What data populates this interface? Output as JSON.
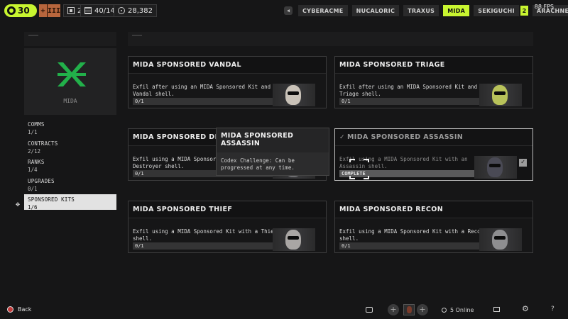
{
  "topbar": {
    "level": "30",
    "rank_marks": [
      "",
      "III"
    ],
    "inventory": "2",
    "capacity": "40/140",
    "currency": "28,382",
    "fps": "88 FPS",
    "tabs": [
      {
        "label": "CYBERACME",
        "active": false
      },
      {
        "label": "NUCALORIC",
        "active": false
      },
      {
        "label": "TRAXUS",
        "active": false
      },
      {
        "label": "MIDA",
        "active": true
      },
      {
        "label": "SEKIGUCHI",
        "active": false,
        "badge": "2"
      },
      {
        "label": "ARACHNE",
        "active": false
      }
    ]
  },
  "faction": {
    "name": "MIDA",
    "accent": "#22b04a"
  },
  "categories": [
    {
      "label": "COMMS",
      "progress": "1/1",
      "active": false
    },
    {
      "label": "CONTRACTS",
      "progress": "2/12",
      "active": false
    },
    {
      "label": "RANKS",
      "progress": "1/4",
      "active": false
    },
    {
      "label": "UPGRADES",
      "progress": "0/1",
      "active": false
    },
    {
      "label": "SPONSORED KITS",
      "progress": "1/6",
      "active": true
    }
  ],
  "challenges": [
    {
      "title": "MIDA SPONSORED VANDAL",
      "desc": "Exfil after using an MIDA Sponsored Kit and a Vandal shell.",
      "progress": "0/1",
      "completed": false,
      "portrait": "vandal-portrait"
    },
    {
      "title": "MIDA SPONSORED TRIAGE",
      "desc": "Exfil after using an MIDA Sponsored Kit and a Triage shell.",
      "progress": "0/1",
      "completed": false,
      "portrait": "triage-portrait"
    },
    {
      "title": "MIDA SPONSORED DESTROYER",
      "desc": "Exfil using a MIDA Sponsored Kit with a Destroyer shell.",
      "progress": "0/1",
      "completed": false,
      "portrait": "destroyer-portrait"
    },
    {
      "title": "MIDA SPONSORED ASSASSIN",
      "desc": "Exfil using a MIDA Sponsored Kit with an Assassin shell.",
      "progress": "COMPLETE",
      "completed": true,
      "portrait": "assassin-portrait"
    },
    {
      "title": "MIDA SPONSORED THIEF",
      "desc": "Exfil using a MIDA Sponsored Kit with a Thief shell.",
      "progress": "0/1",
      "completed": false,
      "portrait": "thief-portrait"
    },
    {
      "title": "MIDA SPONSORED RECON",
      "desc": "Exfil using a MIDA Sponsored Kit with a Recon shell.",
      "progress": "0/1",
      "completed": false,
      "portrait": "recon-portrait"
    }
  ],
  "tooltip": {
    "title": "MIDA SPONSORED ASSASSIN",
    "body": "Codex Challenge: Can be progressed at any time."
  },
  "bottombar": {
    "back_label": "Back",
    "online": "5 Online"
  },
  "icons": {
    "level": "ring-icon",
    "inventory": "box-icon",
    "capacity": "grid-icon",
    "currency": "coin-icon",
    "check": "check-icon",
    "gear": "gear-icon",
    "help": "help-icon",
    "chat": "chat-icon",
    "mail": "mail-icon"
  }
}
